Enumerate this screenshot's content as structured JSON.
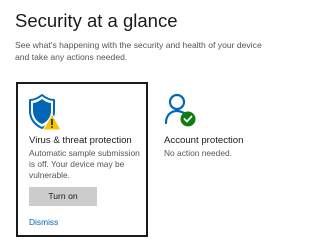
{
  "header": {
    "title": "Security at a glance",
    "subtitle": "See what's happening with the security and health of your device and take any actions needed."
  },
  "cards": {
    "virus": {
      "icon": "shield-warning-icon",
      "title": "Virus & threat protection",
      "description": "Automatic sample submission is off. Your device may be vulnerable.",
      "button_label": "Turn on",
      "dismiss_label": "Dismiss"
    },
    "account": {
      "icon": "person-check-icon",
      "title": "Account protection",
      "status": "No action needed."
    }
  },
  "colors": {
    "accent_blue": "#0067b8",
    "warning_yellow": "#f7c600",
    "ok_green": "#107c10",
    "button_gray": "#cccccc"
  }
}
